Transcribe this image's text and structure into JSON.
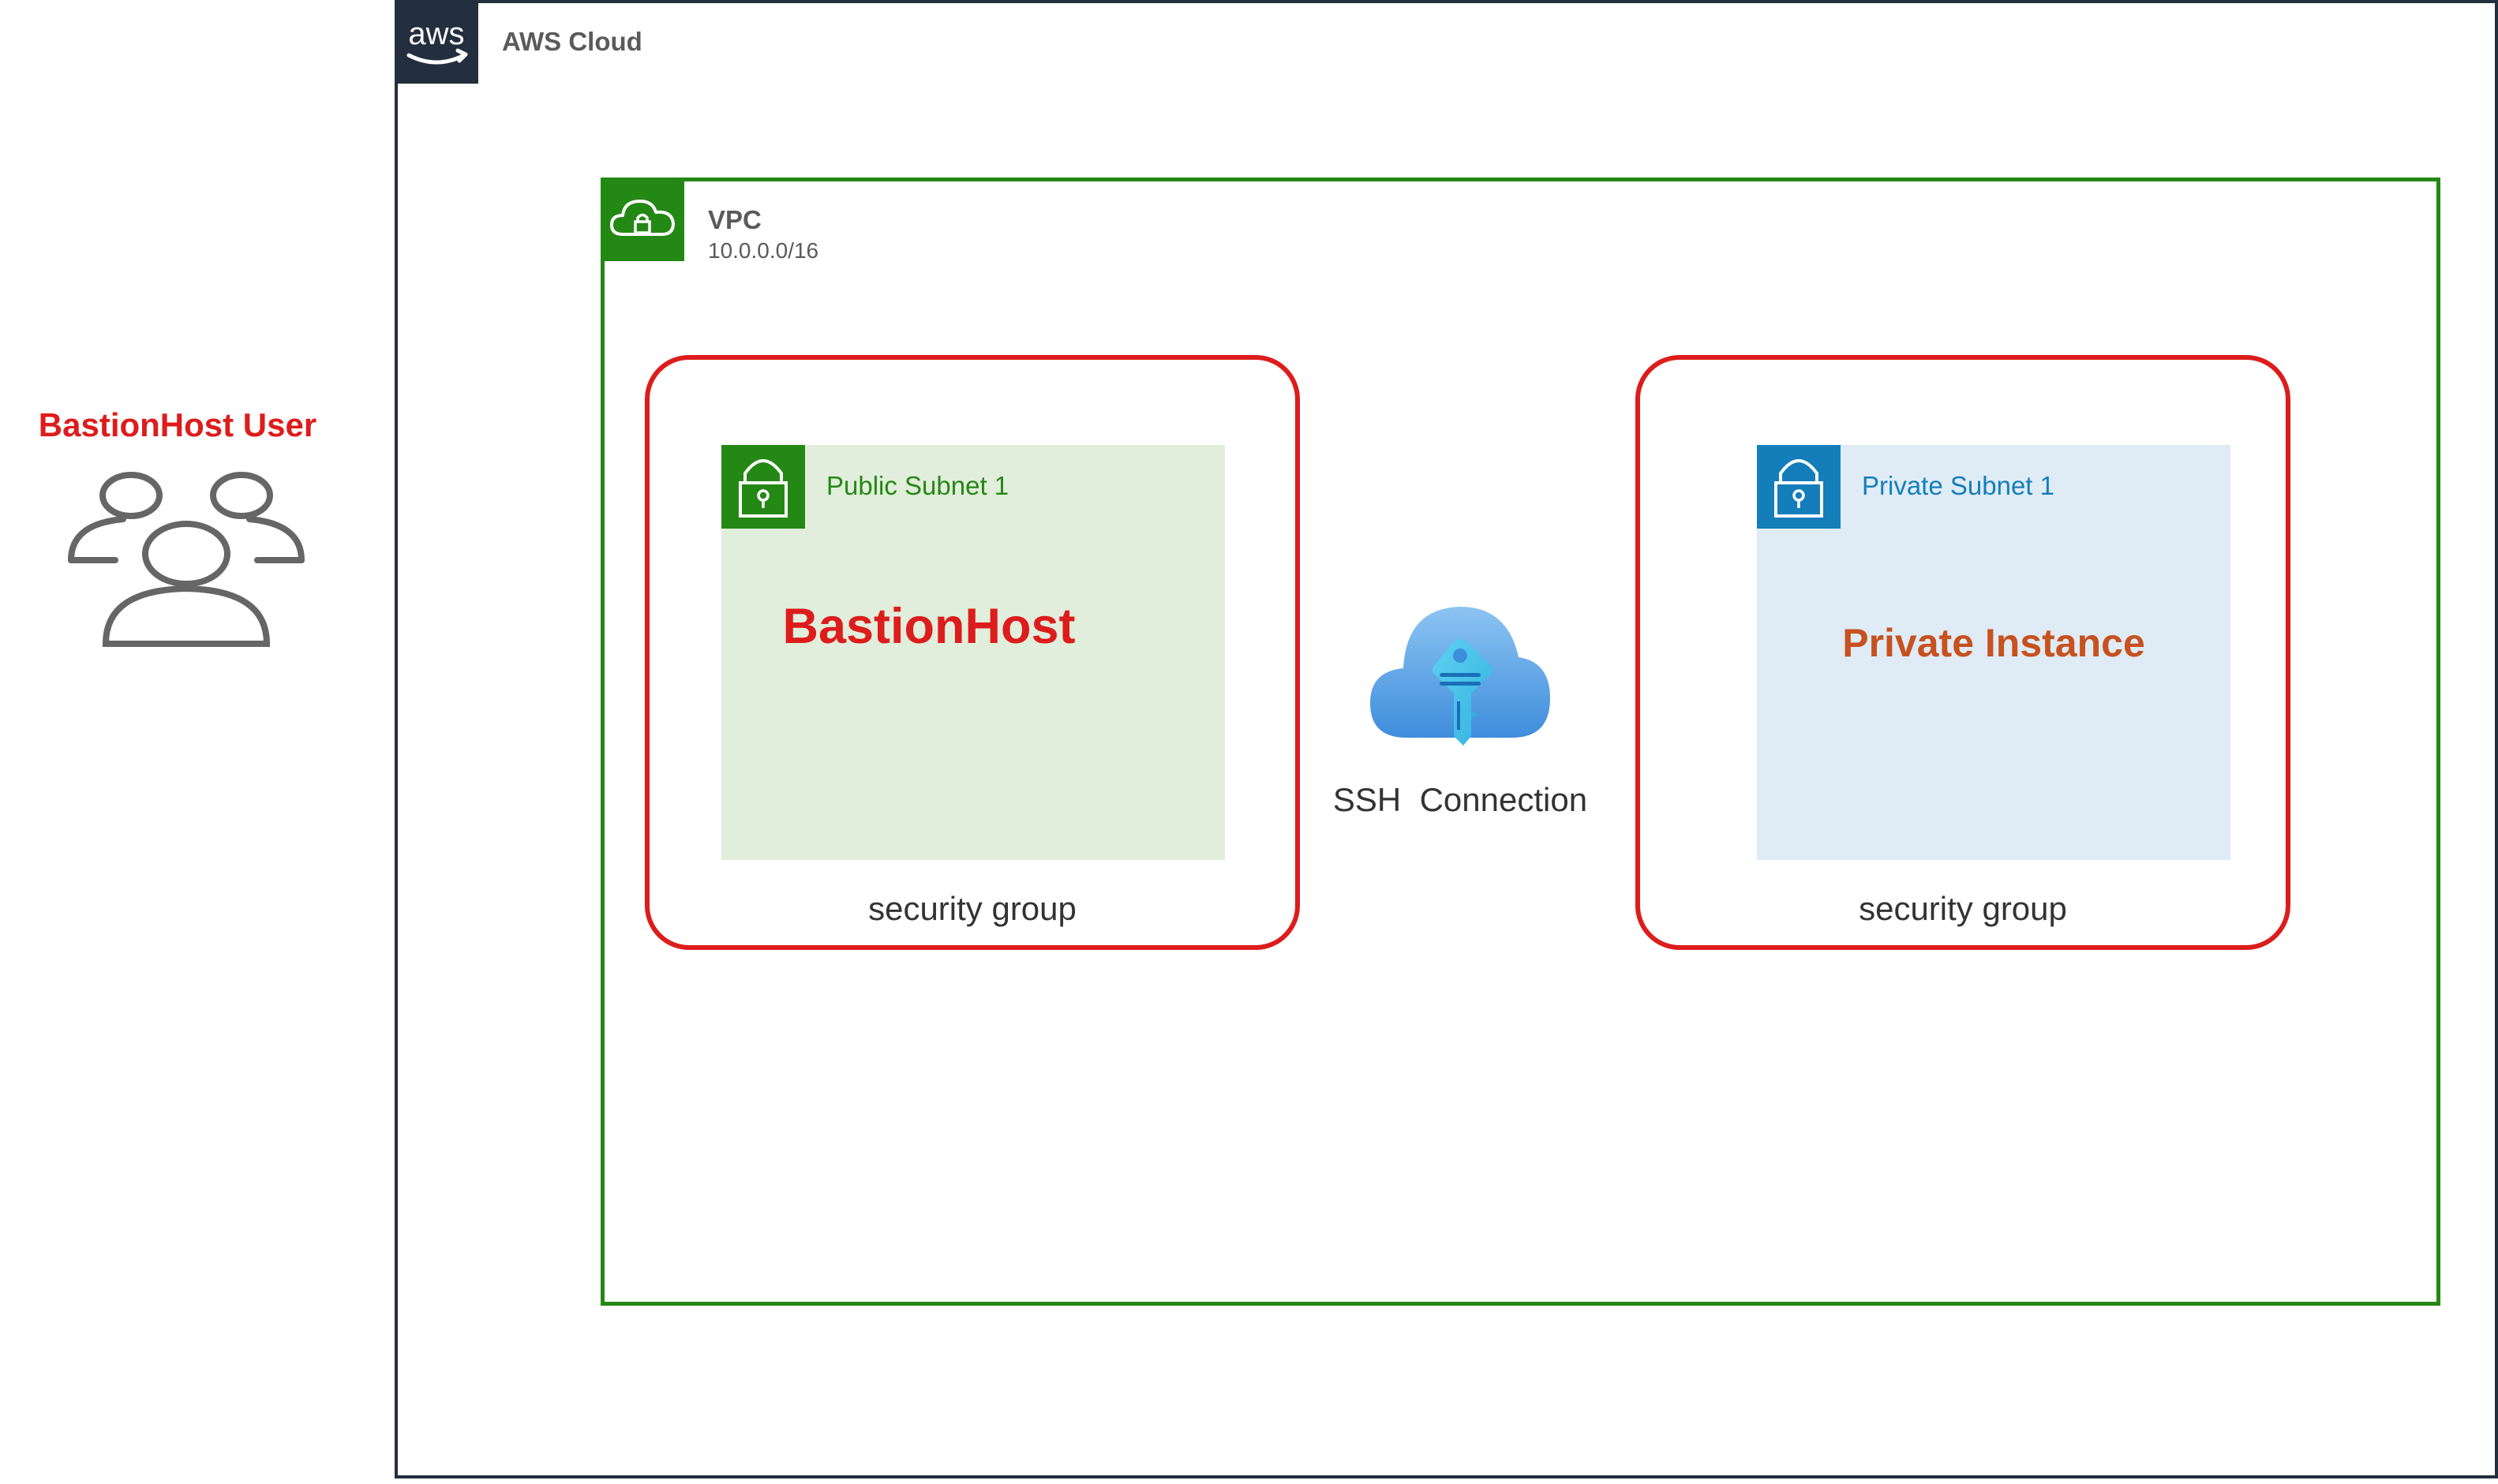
{
  "aws_cloud": {
    "label": "AWS Cloud",
    "logo_text": "aws",
    "icon": "aws-logo-icon",
    "border_color": "#232f3e"
  },
  "vpc": {
    "label": "VPC",
    "cidr": "10.0.0.0/16",
    "icon": "vpc-cloud-lock-icon",
    "border_color": "#248814"
  },
  "public_subnet": {
    "label": "Public Subnet 1",
    "icon": "padlock-icon",
    "color": "#248814",
    "fill": "#e1eedb",
    "instance_label": "BastionHost",
    "security_group_label": "security group"
  },
  "private_subnet": {
    "label": "Private Subnet 1",
    "icon": "padlock-icon",
    "color": "#147eba",
    "fill": "#dfecf5",
    "instance_label": "Private Instance",
    "security_group_label": "security group"
  },
  "ssh": {
    "label": "SSH  Connection",
    "icon": "cloud-key-icon"
  },
  "user": {
    "label": "BastionHost User",
    "icon": "users-icon"
  },
  "colors": {
    "security_group_border": "#dd1c1c",
    "bastion_host_text": "#dd1c1c",
    "private_instance_text": "#c7511f"
  }
}
